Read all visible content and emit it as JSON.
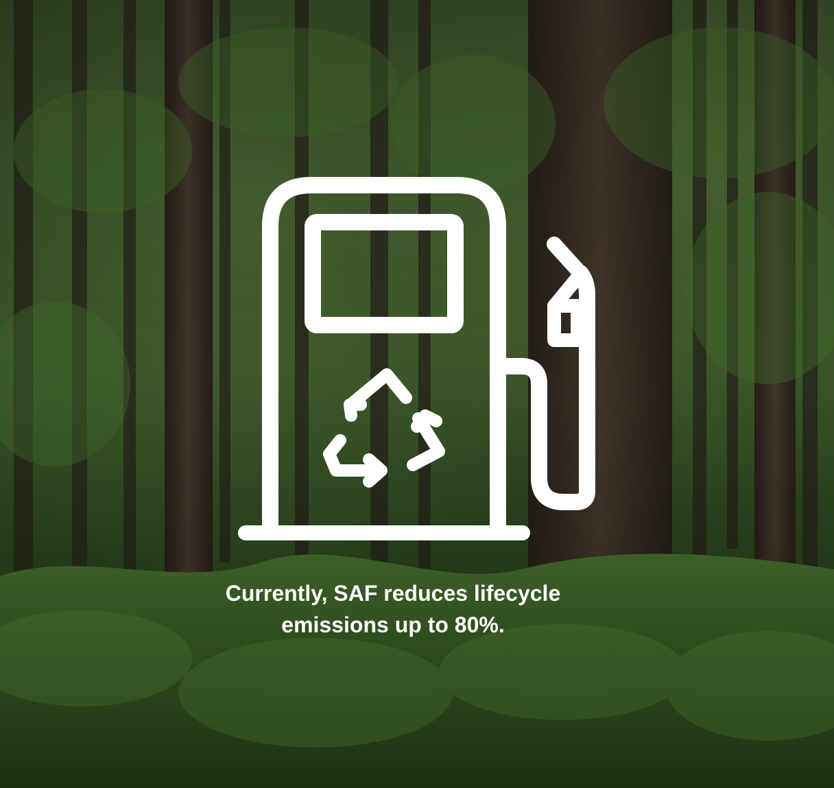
{
  "caption": {
    "line1": "Currently, SAF reduces lifecycle",
    "line2": "emissions up to 80%."
  },
  "background": {
    "subject": "forest",
    "colors": {
      "canopy": "#2f4a22",
      "trunk": "#3a2f24",
      "undergrowth": "#3d6a2a",
      "overlay": "#000000"
    }
  },
  "icon": {
    "name": "fuel-pump-recycle-icon",
    "color": "#ffffff"
  }
}
